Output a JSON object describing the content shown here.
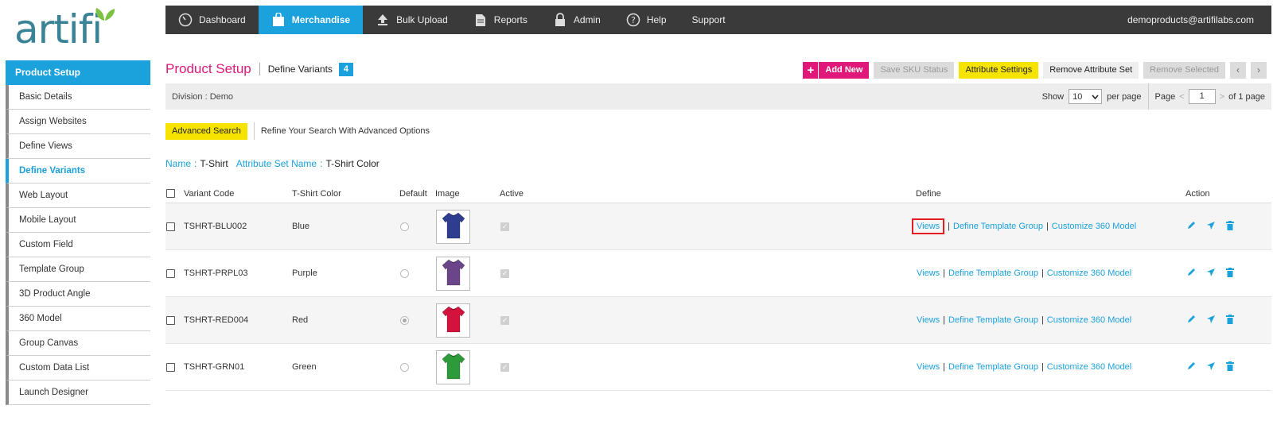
{
  "brand": {
    "logo_text": "artifi",
    "logo_color": "#3a8296",
    "leaf_color": "#7cc242"
  },
  "nav": {
    "items": [
      {
        "label": "Dashboard",
        "icon": "dashboard-icon"
      },
      {
        "label": "Merchandise",
        "icon": "shopping-bag-icon"
      },
      {
        "label": "Bulk Upload",
        "icon": "upload-icon"
      },
      {
        "label": "Reports",
        "icon": "report-icon"
      },
      {
        "label": "Admin",
        "icon": "lock-icon"
      },
      {
        "label": "Help",
        "icon": "help-icon"
      },
      {
        "label": "Support",
        "icon": ""
      }
    ],
    "active": "Merchandise",
    "user": "demoproducts@artifilabs.com"
  },
  "sidebar": {
    "header": "Product Setup",
    "items": [
      {
        "label": "Basic Details"
      },
      {
        "label": "Assign Websites"
      },
      {
        "label": "Define Views"
      },
      {
        "label": "Define Variants"
      },
      {
        "label": "Web Layout"
      },
      {
        "label": "Mobile Layout"
      },
      {
        "label": "Custom Field"
      },
      {
        "label": "Template Group"
      },
      {
        "label": "3D Product Angle"
      },
      {
        "label": "360 Model"
      },
      {
        "label": "Group Canvas"
      },
      {
        "label": "Custom Data List"
      },
      {
        "label": "Launch Designer"
      }
    ],
    "active": "Define Variants"
  },
  "page": {
    "title": "Product Setup",
    "subtitle": "Define Variants",
    "badge": "4"
  },
  "toolbar": {
    "add_new": "Add New",
    "save_sku": "Save SKU Status",
    "attribute_settings": "Attribute Settings",
    "remove_attribute_set": "Remove Attribute Set",
    "remove_selected": "Remove Selected",
    "prev": "‹",
    "next": "›"
  },
  "division": {
    "label": "Division :",
    "value": "Demo"
  },
  "paging": {
    "show_label": "Show",
    "show_value": "10",
    "per_page": "per page",
    "page_label": "Page",
    "prev_glyph": "<",
    "page_value": "1",
    "next_glyph": ">",
    "of_label": "of 1 page"
  },
  "search": {
    "button": "Advanced Search",
    "hint": "Refine Your Search With Advanced Options"
  },
  "filters": {
    "name_label": "Name",
    "name_value": "T-Shirt",
    "set_label": "Attribute Set Name",
    "set_value": "T-Shirt Color"
  },
  "table": {
    "headers": {
      "code": "Variant Code",
      "color": "T-Shirt Color",
      "default": "Default",
      "image": "Image",
      "active": "Active",
      "define": "Define",
      "action": "Action"
    },
    "link_labels": {
      "views": "Views",
      "template": "Define Template Group",
      "model": "Customize 360 Model"
    },
    "rows": [
      {
        "code": "TSHRT-BLU002",
        "color": "Blue",
        "shirt_color": "#2e3d8f",
        "default": false
      },
      {
        "code": "TSHRT-PRPL03",
        "color": "Purple",
        "shirt_color": "#6b4589",
        "default": false
      },
      {
        "code": "TSHRT-RED004",
        "color": "Red",
        "shirt_color": "#d3123d",
        "default": true
      },
      {
        "code": "TSHRT-GRN01",
        "color": "Green",
        "shirt_color": "#2e9b3a",
        "default": false
      }
    ]
  },
  "colors": {
    "accent": "#1ba1dc",
    "magenta": "#e0187a",
    "yellow": "#f6e300",
    "nav_bg": "#3a3a3a",
    "highlight": "#e31b23"
  }
}
